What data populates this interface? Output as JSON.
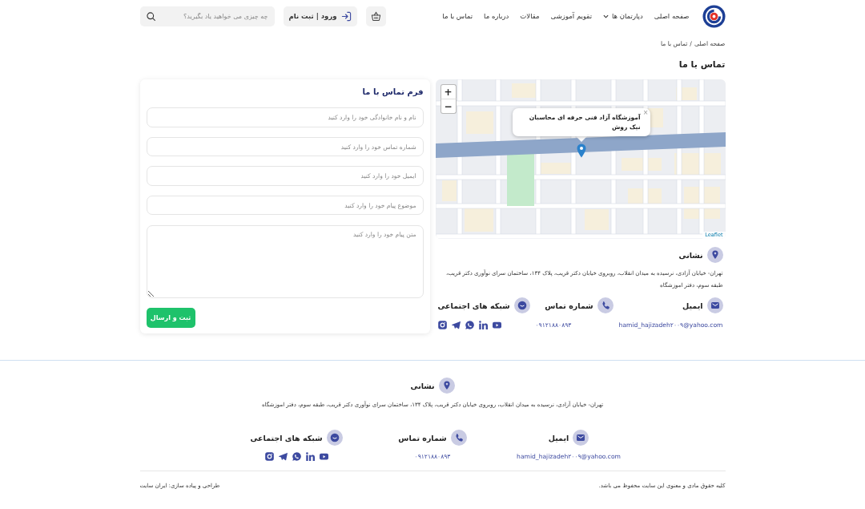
{
  "header": {
    "nav": [
      {
        "label": "صفحه اصلی",
        "has_menu": false
      },
      {
        "label": "دپارتمان ها",
        "has_menu": true
      },
      {
        "label": "تقویم آموزشی",
        "has_menu": false
      },
      {
        "label": "مقالات",
        "has_menu": false
      },
      {
        "label": "درباره ما",
        "has_menu": false
      },
      {
        "label": "تماس با ما",
        "has_menu": false
      }
    ],
    "login": "ورود | ثبت نام",
    "search": {
      "placeholder": "چه چیزی می خواهید یاد بگیرید؟"
    }
  },
  "breadcrumb": {
    "items": [
      "صفحه اصلی",
      "تماس با ما"
    ],
    "separator": "/"
  },
  "page_title": "تماس با ما",
  "map": {
    "zoom_in": "+",
    "zoom_out": "−",
    "popup": {
      "text": "آموزشگاه آزاد فنی حرفه ای محاسبان نیک روش",
      "close": "×"
    },
    "attribution": "Leaflet"
  },
  "contact": {
    "address": {
      "label": "نشانی",
      "text": "تهران- خیابان آزادی، نرسیده به میدان انقلاب، روبروی خیابان دکتر قریب، پلاک ۱۳۴، ساختمان سرای نوآوری دکتر قریب، طبقه سوم، دفتر اموزشگاه"
    },
    "items": [
      {
        "kind": "email",
        "label": "ایمیل",
        "value": "hamid_hajizadeh۲۰۰۹@yahoo.com"
      },
      {
        "kind": "phone",
        "label": "شماره تماس",
        "value": "۰۹۱۲۱۸۸۰۸۹۳"
      },
      {
        "kind": "social",
        "label": "شبکه های اجتماعی"
      }
    ]
  },
  "form": {
    "title": "فرم تماس با ما",
    "fields": [
      {
        "kind": "input",
        "placeholder": "نام و نام خانوادگی خود را وارد کنید"
      },
      {
        "kind": "input",
        "placeholder": "شماره تماس خود را وارد کنید"
      },
      {
        "kind": "input",
        "placeholder": "ایمیل خود را وارد کنید"
      },
      {
        "kind": "input",
        "placeholder": "موضوع پیام خود را وارد کنید"
      },
      {
        "kind": "textarea",
        "placeholder": "متن پیام خود را وارد کنید"
      }
    ],
    "submit": "ثبت و ارسال"
  },
  "footer": {
    "address": {
      "label": "نشانی",
      "text": "تهران- خیابان آزادی، نرسیده به میدان انقلاب، روبروی خیابان دکتر قریب، پلاک ۱۳۴، ساختمان سرای نوآوری دکتر قریب، طبقه سوم، دفتر اموزشگاه"
    },
    "items": [
      {
        "kind": "email",
        "label": "ایمیل",
        "value": "hamid_hajizadeh۲۰۰۹@yahoo.com"
      },
      {
        "kind": "phone",
        "label": "شماره تماس",
        "value": "۰۹۱۲۱۸۸۰۸۹۳"
      },
      {
        "kind": "social",
        "label": "شبکه های اجتماعی"
      }
    ],
    "copyright": "کلیه حقوق مادی و معنوی این سایت محفوظ می باشد.",
    "credit": "طراحی و پیاده سازی: ایران سایت"
  }
}
